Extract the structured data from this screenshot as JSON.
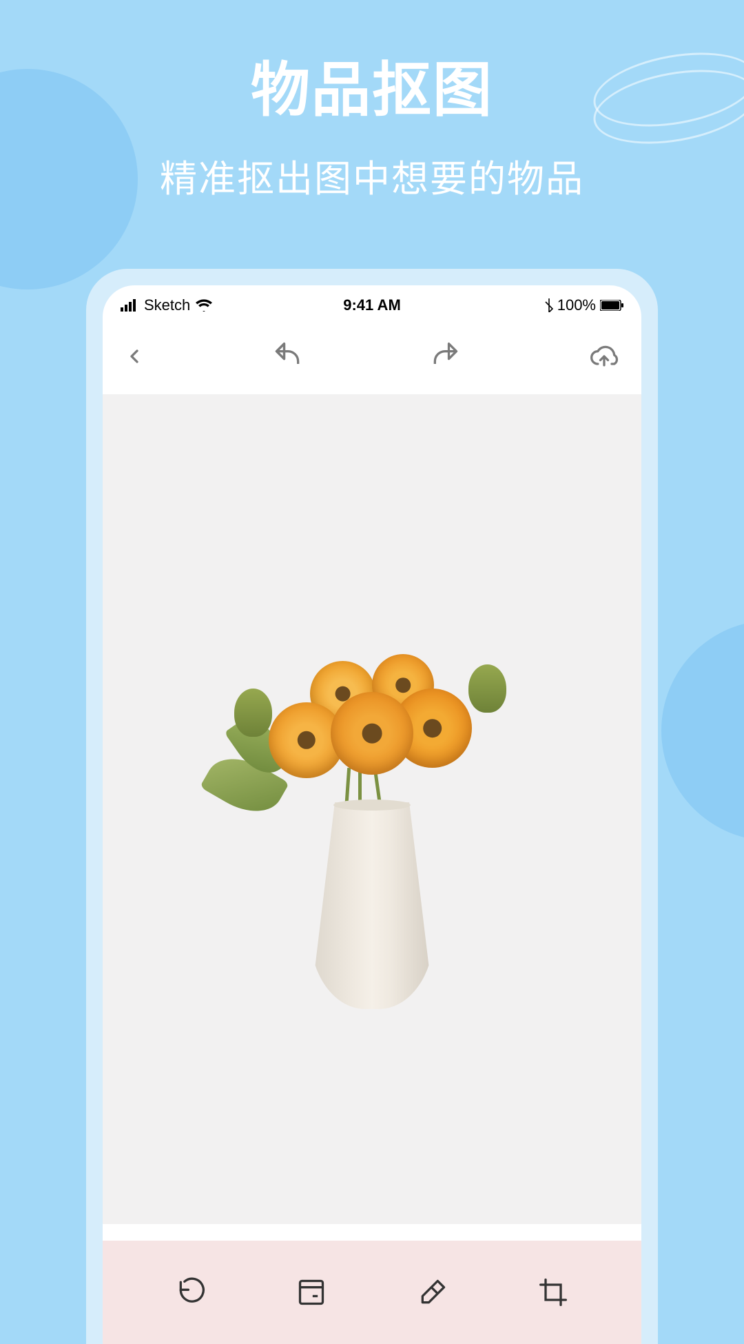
{
  "hero": {
    "title": "物品抠图",
    "subtitle": "精准抠出图中想要的物品"
  },
  "statusBar": {
    "carrier": "Sketch",
    "time": "9:41 AM",
    "battery": "100%"
  },
  "icons": {
    "back": "back-chevron",
    "undo": "undo-arrow",
    "redo": "redo-arrow",
    "cloudUpload": "cloud-upload",
    "reset": "reset-rotate",
    "archive": "archive-box",
    "eraser": "eraser",
    "crop": "crop"
  },
  "canvas": {
    "subject": "sunflower-vase"
  }
}
